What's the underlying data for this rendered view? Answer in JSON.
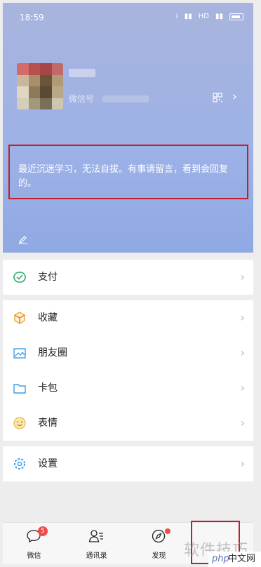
{
  "status_bar": {
    "time": "18:59",
    "network": "HD"
  },
  "profile": {
    "wechat_id_label": "微信号",
    "signature": "最近沉迷学习，无法自拔。有事请留言，看到会回复的。"
  },
  "menu": {
    "pay": "支付",
    "favorites": "收藏",
    "moments": "朋友圈",
    "cards": "卡包",
    "stickers": "表情",
    "settings": "设置"
  },
  "nav": {
    "chats": {
      "label": "微信",
      "badge": "5"
    },
    "contacts": {
      "label": "通讯录"
    },
    "discover": {
      "label": "发现"
    }
  },
  "watermark": {
    "text": "软件技巧",
    "site_php": "php",
    "site_cn": "中文网"
  },
  "colors": {
    "header_gradient_top": "#a8b4dd",
    "header_gradient_bottom": "#8fa9e4",
    "highlight_border": "#c01f2b",
    "badge": "#f24a4a",
    "pay_icon": "#2aae67",
    "blue_icon": "#3b9ee8"
  }
}
